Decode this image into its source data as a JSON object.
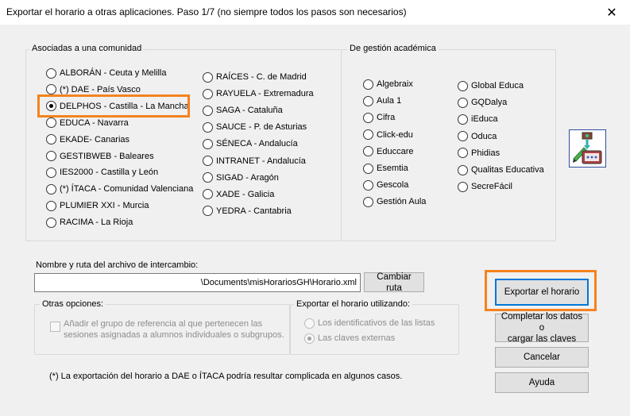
{
  "window": {
    "title": "Exportar el horario a otras aplicaciones.  Paso 1/7 (no siempre todos los pasos son necesarios)"
  },
  "community_group": {
    "title": "Asociadas a una comunidad",
    "col1": [
      {
        "label": "ALBORÁN - Ceuta y Melilla",
        "checked": false
      },
      {
        "label": "(*) DAE - País Vasco",
        "checked": false
      },
      {
        "label": "DELPHOS - Castilla - La Mancha",
        "checked": true
      },
      {
        "label": "EDUCA - Navarra",
        "checked": false
      },
      {
        "label": "EKADE- Canarias",
        "checked": false
      },
      {
        "label": "GESTIBWEB -  Baleares",
        "checked": false
      },
      {
        "label": "IES2000 - Castilla y León",
        "checked": false
      },
      {
        "label": "(*) ÍTACA - Comunidad Valenciana",
        "checked": false
      },
      {
        "label": "PLUMIER XXI - Murcia",
        "checked": false
      },
      {
        "label": "RACIMA - La Rioja",
        "checked": false
      }
    ],
    "col2": [
      {
        "label": "RAÍCES - C. de Madrid",
        "checked": false
      },
      {
        "label": "RAYUELA - Extremadura",
        "checked": false
      },
      {
        "label": "SAGA - Cataluña",
        "checked": false
      },
      {
        "label": "SAUCE - P. de Asturias",
        "checked": false
      },
      {
        "label": "SÉNECA - Andalucía",
        "checked": false
      },
      {
        "label": "INTRANET - Andalucía",
        "checked": false
      },
      {
        "label": "SIGAD - Aragón",
        "checked": false
      },
      {
        "label": "XADE - Galicia",
        "checked": false
      },
      {
        "label": "YEDRA - Cantabria",
        "checked": false
      }
    ]
  },
  "academic_group": {
    "title": "De gestión académica",
    "col1": [
      {
        "label": "Algebraix"
      },
      {
        "label": "Aula 1"
      },
      {
        "label": "Cifra"
      },
      {
        "label": "Click-edu"
      },
      {
        "label": "Educcare"
      },
      {
        "label": "Esemtia"
      },
      {
        "label": "Gescola"
      },
      {
        "label": "Gestión Aula"
      }
    ],
    "col2": [
      {
        "label": "Global Educa"
      },
      {
        "label": "GQDalya"
      },
      {
        "label": "iEduca"
      },
      {
        "label": "Oduca"
      },
      {
        "label": "Phidias"
      },
      {
        "label": "Qualitas Educativa"
      },
      {
        "label": "SecreFácil"
      }
    ]
  },
  "file": {
    "label": "Nombre y ruta del archivo de intercambio:",
    "value": "\\Documents\\misHorariosGH\\Horario.xml",
    "change_button": "Cambiar ruta"
  },
  "other_options": {
    "title": "Otras opciones:",
    "checkbox_label_1": "Añadir el grupo de referencia al que pertenecen las",
    "checkbox_label_2": "sesiones asignadas a alumnos individuales o subgrupos."
  },
  "export_using": {
    "title": "Exportar el horario utilizando:",
    "option1": "Los identificativos de las listas",
    "option2": "Las claves externas"
  },
  "note": "(*) La exportación del horario a DAE o ÍTACA podría resultar complicada en algunos casos.",
  "buttons": {
    "export": "Exportar el horario",
    "complete_1": "Completar los datos o",
    "complete_2": "cargar las claves",
    "cancel": "Cancelar",
    "help": "Ayuda"
  },
  "colors": {
    "highlight": "#f5821f",
    "default_button_border": "#0078d7"
  },
  "icons": {
    "close": "close-icon",
    "export_tool": "export-tool-icon"
  }
}
